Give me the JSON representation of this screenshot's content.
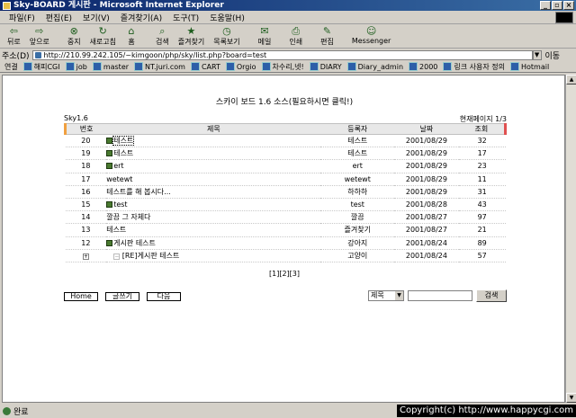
{
  "window": {
    "title": "Sky-BOARD 게시판 - Microsoft Internet Explorer",
    "buttons": [
      "_",
      "▫",
      "×"
    ]
  },
  "menu": [
    "파일(F)",
    "편집(E)",
    "보기(V)",
    "즐겨찾기(A)",
    "도구(T)",
    "도움말(H)"
  ],
  "toolbar": [
    {
      "label": "뒤로",
      "icon": "back-arrow-icon",
      "glyph": "⇦"
    },
    {
      "label": "앞으로",
      "icon": "forward-arrow-icon",
      "glyph": "⇨"
    },
    {
      "label": "중지",
      "icon": "stop-icon",
      "glyph": "⊗"
    },
    {
      "label": "새로고침",
      "icon": "refresh-icon",
      "glyph": "↻"
    },
    {
      "label": "홈",
      "icon": "home-icon",
      "glyph": "⌂"
    },
    {
      "label": "검색",
      "icon": "search-icon",
      "glyph": "⌕"
    },
    {
      "label": "즐겨찾기",
      "icon": "favorites-icon",
      "glyph": "★"
    },
    {
      "label": "목록보기",
      "icon": "history-icon",
      "glyph": "◷"
    },
    {
      "label": "메일",
      "icon": "mail-icon",
      "glyph": "✉"
    },
    {
      "label": "인쇄",
      "icon": "print-icon",
      "glyph": "⎙"
    },
    {
      "label": "편집",
      "icon": "edit-icon",
      "glyph": "✎"
    },
    {
      "label": "Messenger",
      "icon": "messenger-icon",
      "glyph": "☺"
    }
  ],
  "address": {
    "label": "주소(D)",
    "url": "http://210.99.242.105/~kimgoon/php/sky/list.php?board=test",
    "go": "이동"
  },
  "links": {
    "label": "연결",
    "items": [
      "해피CGI",
      "job",
      "master",
      "NT.juri.com",
      "CART",
      "Orgio",
      "차수리,넷!",
      "DIARY",
      "Diary_admin",
      "2000",
      "링크 사용자 정의",
      "Hotmail"
    ]
  },
  "board": {
    "title": "스카이 보드 1.6 소스(필요하시면 클릭!)",
    "name": "Sky1.6",
    "page_info": "현재페이지 1/3",
    "headers": {
      "num": "번호",
      "title": "제목",
      "author": "등록자",
      "date": "날짜",
      "views": "조회"
    },
    "rows": [
      {
        "num": "20",
        "title": "테스트",
        "author": "테스트",
        "date": "2001/08/29",
        "views": "32",
        "pic": true
      },
      {
        "num": "19",
        "title": "테스트",
        "author": "테스트",
        "date": "2001/08/29",
        "views": "17",
        "pic": true
      },
      {
        "num": "18",
        "title": "ert",
        "author": "ert",
        "date": "2001/08/29",
        "views": "23",
        "pic": true
      },
      {
        "num": "17",
        "title": "wetewt",
        "author": "wetewt",
        "date": "2001/08/29",
        "views": "11",
        "pic": false
      },
      {
        "num": "16",
        "title": "테스트를 해 봅시다...",
        "author": "하하하",
        "date": "2001/08/29",
        "views": "31",
        "pic": false
      },
      {
        "num": "15",
        "title": "test",
        "author": "test",
        "date": "2001/08/28",
        "views": "43",
        "pic": true
      },
      {
        "num": "14",
        "title": "깔끔 그 자체다",
        "author": "깔끔",
        "date": "2001/08/27",
        "views": "97",
        "pic": false
      },
      {
        "num": "13",
        "title": "테스트",
        "author": "즐겨찾기",
        "date": "2001/08/27",
        "views": "21",
        "pic": false
      },
      {
        "num": "12",
        "title": "게시판 테스트",
        "author": "강아지",
        "date": "2001/08/24",
        "views": "89",
        "pic": true
      },
      {
        "num": "",
        "title": "[RE]게시판 테스트",
        "author": "고양이",
        "date": "2001/08/24",
        "views": "57",
        "pic": false,
        "reply": true
      }
    ],
    "pager": "[1][2][3]",
    "buttons": {
      "home": "Home",
      "write": "글쓰기",
      "next": "다음"
    },
    "search": {
      "field": "제목",
      "button": "검색"
    }
  },
  "status": {
    "text": "완료",
    "copyright": "Copyright(c) http://www.happycgi.com"
  }
}
